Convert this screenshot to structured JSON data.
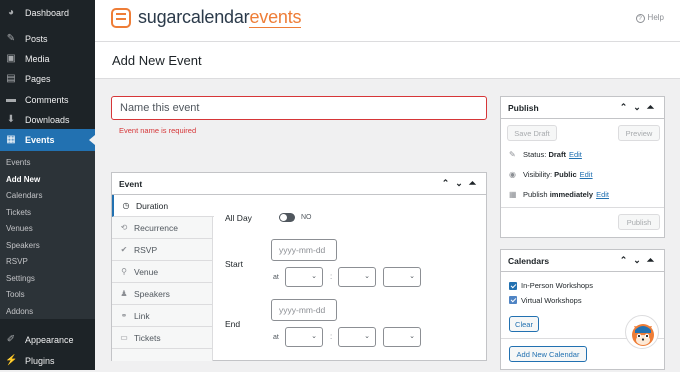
{
  "sidebar": {
    "items": [
      {
        "label": "Dashboard",
        "icon": "dashboard-icon",
        "glyph": "◕"
      },
      {
        "label": "Posts",
        "icon": "pushpin-icon",
        "glyph": "✎"
      },
      {
        "label": "Media",
        "icon": "media-icon",
        "glyph": "▣"
      },
      {
        "label": "Pages",
        "icon": "pages-icon",
        "glyph": "▤"
      },
      {
        "label": "Comments",
        "icon": "comments-icon",
        "glyph": "▬"
      },
      {
        "label": "Downloads",
        "icon": "downloads-icon",
        "glyph": "⬇"
      },
      {
        "label": "Events",
        "icon": "events-icon",
        "glyph": "▦"
      }
    ],
    "sub_items": [
      "Events",
      "Add New",
      "Calendars",
      "Tickets",
      "Venues",
      "Speakers",
      "RSVP",
      "Settings",
      "Tools",
      "Addons"
    ],
    "bottom_items": [
      {
        "label": "Appearance",
        "icon": "appearance-icon",
        "glyph": "✐"
      },
      {
        "label": "Plugins",
        "icon": "plugins-icon",
        "glyph": "⚡"
      }
    ]
  },
  "header": {
    "logo_sugar": "sugarcalendar",
    "logo_events": "events",
    "help": "Help",
    "help_icon": "?"
  },
  "page": {
    "title": "Add New Event"
  },
  "event_name": {
    "placeholder": "Name this event",
    "error": "Event name is required"
  },
  "event_panel": {
    "title": "Event",
    "tabs": [
      {
        "label": "Duration",
        "icon": "clock-icon",
        "glyph": "◷"
      },
      {
        "label": "Recurrence",
        "icon": "recurrence-icon",
        "glyph": "⟲"
      },
      {
        "label": "RSVP",
        "icon": "rsvp-icon",
        "glyph": "✔"
      },
      {
        "label": "Venue",
        "icon": "location-icon",
        "glyph": "⚲"
      },
      {
        "label": "Speakers",
        "icon": "speakers-icon",
        "glyph": "♟"
      },
      {
        "label": "Link",
        "icon": "link-icon",
        "glyph": "⚭"
      },
      {
        "label": "Tickets",
        "icon": "tickets-icon",
        "glyph": "▭"
      }
    ],
    "all_day_label": "All Day",
    "all_day_value": "NO",
    "start_label": "Start",
    "end_label": "End",
    "date_placeholder": "yyyy-mm-dd",
    "at_label": "at",
    "colon": ":",
    "chevron": "⌄"
  },
  "publish_panel": {
    "title": "Publish",
    "save_draft": "Save Draft",
    "preview": "Preview",
    "status_label": "Status:",
    "status_value": "Draft",
    "visibility_label": "Visibility:",
    "visibility_value": "Public",
    "publish_label": "Publish",
    "publish_value": "immediately",
    "edit": "Edit",
    "publish_button": "Publish"
  },
  "calendars_panel": {
    "title": "Calendars",
    "items": [
      {
        "label": "In-Person Workshops",
        "checked": true
      },
      {
        "label": "Virtual Workshops",
        "checked": false
      }
    ],
    "clear": "Clear",
    "add_new": "Add New Calendar"
  },
  "panel_controls": "⌃⌄⏶",
  "colors": {
    "accent": "#2271b1",
    "error": "#d63638",
    "brand": "#ee7d37",
    "sidebar": "#1d2327"
  }
}
